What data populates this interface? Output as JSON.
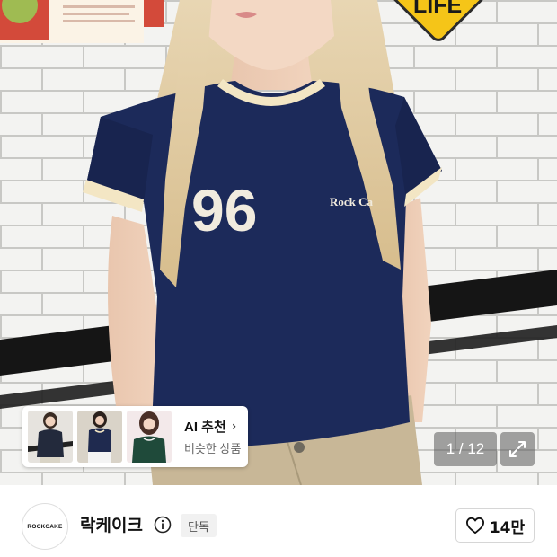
{
  "photo": {
    "sign_text": "LIFE",
    "shirt_number": "96",
    "shirt_script": "Rock Ca",
    "colors": {
      "shirt": "#1c2a5a",
      "trim": "#f3e6c4",
      "tile": "#f4f4f2",
      "grout": "#c9c9c6",
      "stripe": "#151515",
      "sign": "#f5c518"
    }
  },
  "ai_recommendation": {
    "title": "AI 추천",
    "chevron": "›",
    "subtitle": "비슷한 상품",
    "thumbnails": [
      "similar-product-1",
      "similar-product-2",
      "similar-product-3"
    ]
  },
  "pager": {
    "current": 1,
    "total": 12,
    "text": "1 / 12"
  },
  "brand": {
    "logo_text": "ROCKCAKE",
    "name": "락케이크",
    "badge": "단독"
  },
  "like": {
    "count_label": "14만"
  },
  "icons": {
    "expand": "expand-icon",
    "info": "info-icon",
    "heart": "heart-icon",
    "chevron": "chevron-right-icon"
  }
}
